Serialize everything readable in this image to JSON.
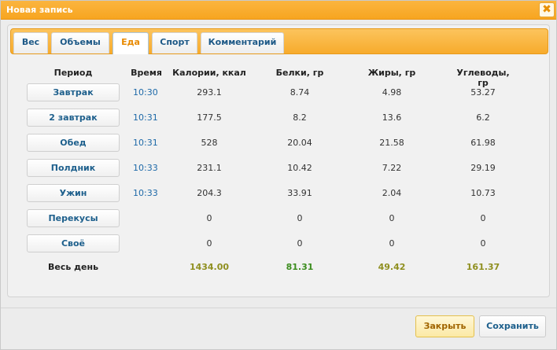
{
  "window": {
    "title": "Новая запись"
  },
  "tabs": [
    "Вес",
    "Объемы",
    "Еда",
    "Спорт",
    "Комментарий"
  ],
  "active_tab": "Еда",
  "columns": [
    "Период",
    "Время",
    "Калории, ккал",
    "Белки, гр",
    "Жиры, гр",
    "Углеводы, гр"
  ],
  "rows": [
    {
      "period": "Завтрак",
      "time": "10:30",
      "kcal": "293.1",
      "protein": "8.74",
      "fat": "4.98",
      "carbs": "53.27"
    },
    {
      "period": "2 завтрак",
      "time": "10:31",
      "kcal": "177.5",
      "protein": "8.2",
      "fat": "13.6",
      "carbs": "6.2"
    },
    {
      "period": "Обед",
      "time": "10:31",
      "kcal": "528",
      "protein": "20.04",
      "fat": "21.58",
      "carbs": "61.98"
    },
    {
      "period": "Полдник",
      "time": "10:33",
      "kcal": "231.1",
      "protein": "10.42",
      "fat": "7.22",
      "carbs": "29.19"
    },
    {
      "period": "Ужин",
      "time": "10:33",
      "kcal": "204.3",
      "protein": "33.91",
      "fat": "2.04",
      "carbs": "10.73"
    },
    {
      "period": "Перекусы",
      "time": "",
      "kcal": "0",
      "protein": "0",
      "fat": "0",
      "carbs": "0"
    },
    {
      "period": "Своё",
      "time": "",
      "kcal": "0",
      "protein": "0",
      "fat": "0",
      "carbs": "0"
    }
  ],
  "total": {
    "label": "Весь день",
    "kcal": "1434.00",
    "protein": "81.31",
    "fat": "49.42",
    "carbs": "161.37"
  },
  "total_colors": {
    "kcal": "#8f8f1f",
    "protein": "#3c8d1f",
    "fat": "#8f8f1f",
    "carbs": "#8f8f1f"
  },
  "buttons": {
    "close": "Закрыть",
    "save": "Сохранить"
  },
  "icons": {
    "close": "close-icon"
  },
  "colors": {
    "accent": "#f7a520",
    "link": "#1d5f8c"
  }
}
